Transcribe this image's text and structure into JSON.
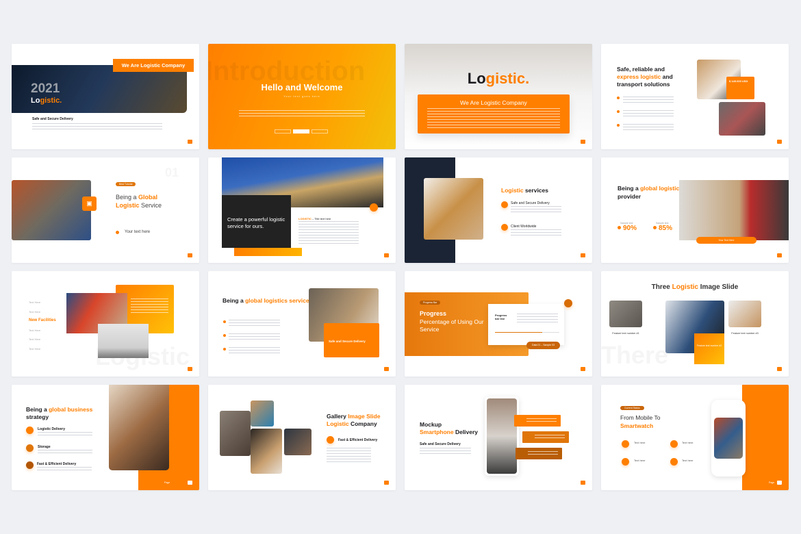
{
  "accent": "#ff7f00",
  "slides": [
    {
      "label": "We Are Logistic Company",
      "year": "2021",
      "brand_a": "Lo",
      "brand_b": "gistic.",
      "heading": "Safe and Secure Delivery"
    },
    {
      "ghost": "Introduction",
      "title": "Hello and Welcome",
      "subtitle": "Your text goes here"
    },
    {
      "brand_a": "Lo",
      "brand_b": "gistic.",
      "box_title": "We Are Logistic Company"
    },
    {
      "title_a": "Safe, reliable and",
      "title_b": "express logistic",
      "title_c": " and",
      "title_d": "transport solutions",
      "price": "$ 145.000 USD"
    },
    {
      "number": "01",
      "badge": "Best Tutorial",
      "title_a": "Being a ",
      "title_b": "Global",
      "title_c": "Logistic",
      "title_d": " Service",
      "item": "Your text here"
    },
    {
      "title": "Create a powerful logistic service for ours.",
      "label_a": "LOGISTIC",
      "label_b": " – Title text here"
    },
    {
      "title_a": "Logistic",
      "title_b": " services",
      "items": [
        "Safe and Secure Delivery",
        "Client Worldwide"
      ]
    },
    {
      "title_a": "Being a ",
      "title_b": "global logistics service",
      "title_c": "provider",
      "stats": [
        {
          "label": "Sample text",
          "value": "90%"
        },
        {
          "label": "Sample text",
          "value": "85%"
        }
      ],
      "button": "Your Text Here"
    },
    {
      "items": [
        "Text Here",
        "Text Here",
        "New Facilities",
        "Text Here",
        "Text Here",
        "Text Here"
      ],
      "ghost": "Logistic"
    },
    {
      "title_a": "Being a ",
      "title_b": "global logistics service",
      "title_c": " provider",
      "card": "Safe and Secure Delivery"
    },
    {
      "badge": "Progress Bar",
      "title_a": "Progress",
      "title_b": "Percentage of Using Our Service",
      "bar_label": "Progress bar line",
      "progress": 0.73,
      "button": "Data 01 – Sample 03"
    },
    {
      "title_a": "Three ",
      "title_b": "Logistic",
      "title_c": " Image Slide",
      "features": [
        "Feature text number #1",
        "Feature text number #2",
        "Feature text number #3"
      ],
      "ghost": "There"
    },
    {
      "title_a": "Being a ",
      "title_b": "global business",
      "title_c": "strategy",
      "items": [
        "Logistic Delivery",
        "Storage",
        "Fast & Efficient Delivery"
      ],
      "page": "Page"
    },
    {
      "title_a": "Gallery ",
      "title_b": "Image Slide",
      "title_c": "Logistic",
      "title_d": " Company",
      "item": "Fast & Efficient Delivery"
    },
    {
      "title_a": "Mockup",
      "title_b": "Smartphone",
      "title_c": " Delivery",
      "heading": "Safe and Secure Delivery"
    },
    {
      "badge": "Current Status",
      "title_a": "From Mobile To",
      "title_b": "Smartwatch",
      "items": [
        "Text here",
        "Text here",
        "Text here",
        "Text here"
      ],
      "page": "Page"
    }
  ]
}
